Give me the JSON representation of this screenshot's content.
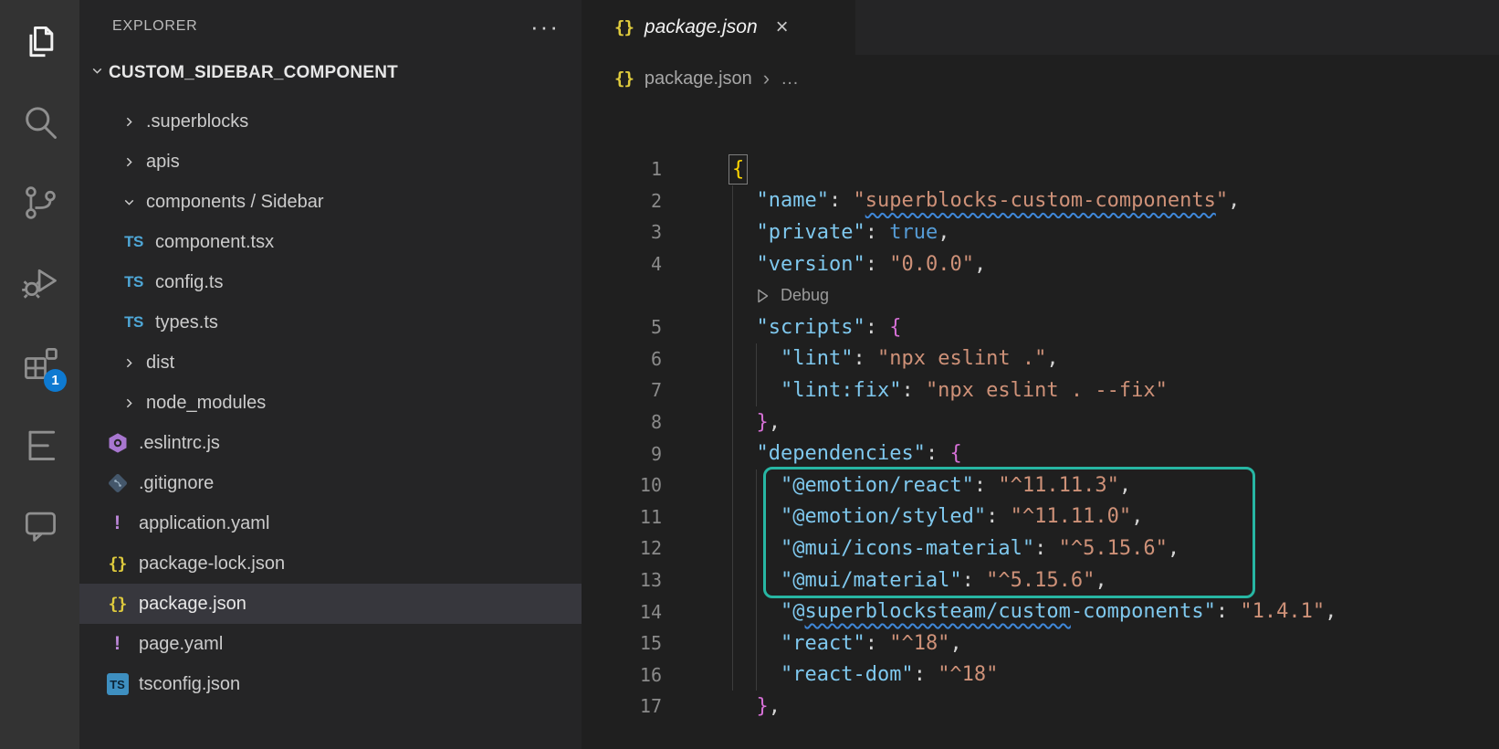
{
  "colors": {
    "activity_bar_bg": "#333333",
    "sidebar_bg": "#252526",
    "editor_bg": "#1f1f1f",
    "selected_row_bg": "#37373d",
    "badge_bg": "#0e7ad1",
    "annotation_highlight": "#27b6a3",
    "json_key": "#7fc8ee",
    "json_string": "#ce9178",
    "json_keyword": "#569cd6",
    "brace_gold": "#ffd700",
    "brace_pink": "#d670d6",
    "squiggle": "#3f87d8"
  },
  "activity_bar": {
    "items": [
      {
        "name": "explorer",
        "active": true
      },
      {
        "name": "search",
        "active": false
      },
      {
        "name": "source-control",
        "active": false
      },
      {
        "name": "run-and-debug",
        "active": false
      },
      {
        "name": "extensions",
        "active": false,
        "badge": "1"
      },
      {
        "name": "outline-list",
        "active": false
      },
      {
        "name": "chat",
        "active": false
      }
    ],
    "extensions_badge": "1"
  },
  "explorer": {
    "title": "EXPLORER",
    "more_label": "···",
    "root_label": "CUSTOM_SIDEBAR_COMPONENT",
    "items": [
      {
        "label": ".superblocks",
        "kind": "folder",
        "state": "collapsed",
        "depth": 1
      },
      {
        "label": "apis",
        "kind": "folder",
        "state": "collapsed",
        "depth": 1
      },
      {
        "label": "components / Sidebar",
        "kind": "folder",
        "state": "expanded",
        "depth": 1
      },
      {
        "label": "component.tsx",
        "kind": "file",
        "icon": "ts",
        "depth": 2
      },
      {
        "label": "config.ts",
        "kind": "file",
        "icon": "ts",
        "depth": 2
      },
      {
        "label": "types.ts",
        "kind": "file",
        "icon": "ts",
        "depth": 2
      },
      {
        "label": "dist",
        "kind": "folder",
        "state": "collapsed",
        "depth": 1
      },
      {
        "label": "node_modules",
        "kind": "folder",
        "state": "collapsed",
        "depth": 1
      },
      {
        "label": ".eslintrc.js",
        "kind": "file",
        "icon": "eslint",
        "depth": 1
      },
      {
        "label": ".gitignore",
        "kind": "file",
        "icon": "git",
        "depth": 1
      },
      {
        "label": "application.yaml",
        "kind": "file",
        "icon": "yaml",
        "depth": 1
      },
      {
        "label": "package-lock.json",
        "kind": "file",
        "icon": "json",
        "depth": 1
      },
      {
        "label": "package.json",
        "kind": "file",
        "icon": "json",
        "depth": 1,
        "selected": true
      },
      {
        "label": "page.yaml",
        "kind": "file",
        "icon": "yaml",
        "depth": 1
      },
      {
        "label": "tsconfig.json",
        "kind": "file",
        "icon": "tsconfig",
        "depth": 1
      }
    ]
  },
  "editor": {
    "tab": {
      "label": "package.json",
      "icon": "json-braces",
      "close": "×",
      "preview_italic": true
    },
    "breadcrumb": {
      "icon": "json-braces",
      "file": "package.json",
      "separator": "›",
      "more": "…"
    },
    "codelens": {
      "label": "Debug",
      "after_line": 4
    },
    "code_lines": [
      {
        "num": 1,
        "tokens": [
          {
            "t": "{",
            "c": "b1",
            "box": true
          }
        ]
      },
      {
        "num": 2,
        "tokens": [
          {
            "t": "  ",
            "c": "p"
          },
          {
            "t": "\"name\"",
            "c": "k"
          },
          {
            "t": ": ",
            "c": "p"
          },
          {
            "t": "\"",
            "c": "s"
          },
          {
            "t": "superblocks-custom-components",
            "c": "s",
            "u": true
          },
          {
            "t": "\"",
            "c": "s"
          },
          {
            "t": ",",
            "c": "p"
          }
        ]
      },
      {
        "num": 3,
        "tokens": [
          {
            "t": "  ",
            "c": "p"
          },
          {
            "t": "\"private\"",
            "c": "k"
          },
          {
            "t": ": ",
            "c": "p"
          },
          {
            "t": "true",
            "c": "t"
          },
          {
            "t": ",",
            "c": "p"
          }
        ]
      },
      {
        "num": 4,
        "tokens": [
          {
            "t": "  ",
            "c": "p"
          },
          {
            "t": "\"version\"",
            "c": "k"
          },
          {
            "t": ": ",
            "c": "p"
          },
          {
            "t": "\"0.0.0\"",
            "c": "s"
          },
          {
            "t": ",",
            "c": "p"
          }
        ]
      },
      {
        "num": 5,
        "tokens": [
          {
            "t": "  ",
            "c": "p"
          },
          {
            "t": "\"scripts\"",
            "c": "k"
          },
          {
            "t": ": ",
            "c": "p"
          },
          {
            "t": "{",
            "c": "b2"
          }
        ]
      },
      {
        "num": 6,
        "tokens": [
          {
            "t": "    ",
            "c": "p"
          },
          {
            "t": "\"lint\"",
            "c": "k"
          },
          {
            "t": ": ",
            "c": "p"
          },
          {
            "t": "\"npx eslint .\"",
            "c": "s"
          },
          {
            "t": ",",
            "c": "p"
          }
        ]
      },
      {
        "num": 7,
        "tokens": [
          {
            "t": "    ",
            "c": "p"
          },
          {
            "t": "\"lint:fix\"",
            "c": "k"
          },
          {
            "t": ": ",
            "c": "p"
          },
          {
            "t": "\"npx eslint . --fix\"",
            "c": "s"
          }
        ]
      },
      {
        "num": 8,
        "tokens": [
          {
            "t": "  ",
            "c": "p"
          },
          {
            "t": "}",
            "c": "b2"
          },
          {
            "t": ",",
            "c": "p"
          }
        ]
      },
      {
        "num": 9,
        "tokens": [
          {
            "t": "  ",
            "c": "p"
          },
          {
            "t": "\"dependencies\"",
            "c": "k"
          },
          {
            "t": ": ",
            "c": "p"
          },
          {
            "t": "{",
            "c": "b2"
          }
        ]
      },
      {
        "num": 10,
        "tokens": [
          {
            "t": "    ",
            "c": "p"
          },
          {
            "t": "\"@emotion/react\"",
            "c": "k"
          },
          {
            "t": ": ",
            "c": "p"
          },
          {
            "t": "\"^11.11.3\"",
            "c": "s"
          },
          {
            "t": ",",
            "c": "p"
          }
        ]
      },
      {
        "num": 11,
        "tokens": [
          {
            "t": "    ",
            "c": "p"
          },
          {
            "t": "\"@emotion/styled\"",
            "c": "k"
          },
          {
            "t": ": ",
            "c": "p"
          },
          {
            "t": "\"^11.11.0\"",
            "c": "s"
          },
          {
            "t": ",",
            "c": "p"
          }
        ]
      },
      {
        "num": 12,
        "tokens": [
          {
            "t": "    ",
            "c": "p"
          },
          {
            "t": "\"@mui/icons-material\"",
            "c": "k"
          },
          {
            "t": ": ",
            "c": "p"
          },
          {
            "t": "\"^5.15.6\"",
            "c": "s"
          },
          {
            "t": ",",
            "c": "p"
          }
        ]
      },
      {
        "num": 13,
        "tokens": [
          {
            "t": "    ",
            "c": "p"
          },
          {
            "t": "\"@mui/material\"",
            "c": "k"
          },
          {
            "t": ": ",
            "c": "p"
          },
          {
            "t": "\"^5.15.6\"",
            "c": "s"
          },
          {
            "t": ",",
            "c": "p"
          }
        ]
      },
      {
        "num": 14,
        "tokens": [
          {
            "t": "    ",
            "c": "p"
          },
          {
            "t": "\"@",
            "c": "k"
          },
          {
            "t": "superblocksteam/custom",
            "c": "k",
            "u": true
          },
          {
            "t": "-components\"",
            "c": "k"
          },
          {
            "t": ": ",
            "c": "p"
          },
          {
            "t": "\"1.4.1\"",
            "c": "s"
          },
          {
            "t": ",",
            "c": "p"
          }
        ]
      },
      {
        "num": 15,
        "tokens": [
          {
            "t": "    ",
            "c": "p"
          },
          {
            "t": "\"react\"",
            "c": "k"
          },
          {
            "t": ": ",
            "c": "p"
          },
          {
            "t": "\"^18\"",
            "c": "s"
          },
          {
            "t": ",",
            "c": "p"
          }
        ]
      },
      {
        "num": 16,
        "tokens": [
          {
            "t": "    ",
            "c": "p"
          },
          {
            "t": "\"react-dom\"",
            "c": "k"
          },
          {
            "t": ": ",
            "c": "p"
          },
          {
            "t": "\"^18\"",
            "c": "s"
          }
        ]
      },
      {
        "num": 17,
        "tokens": [
          {
            "t": "  ",
            "c": "p"
          },
          {
            "t": "}",
            "c": "b2"
          },
          {
            "t": ",",
            "c": "p"
          }
        ]
      }
    ],
    "annotation": {
      "lines": "10-13",
      "color": "#27b6a3"
    }
  }
}
